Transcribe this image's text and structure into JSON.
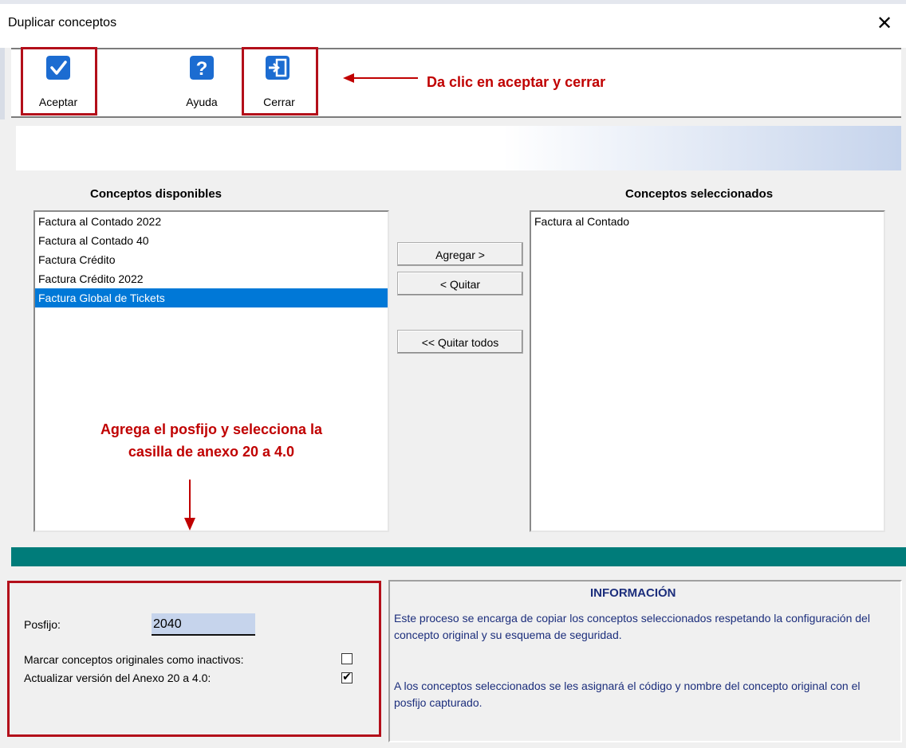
{
  "window": {
    "title": "Duplicar conceptos",
    "close_glyph": "✕"
  },
  "toolbar": {
    "buttons": [
      {
        "label": "Aceptar",
        "icon": "check-icon",
        "color": "#1c6cd1"
      },
      {
        "label": "Ayuda",
        "icon": "help-icon",
        "color": "#1c6cd1"
      },
      {
        "label": "Cerrar",
        "icon": "exit-door-icon",
        "color": "#1c6cd1"
      }
    ]
  },
  "annotations": {
    "toolbar_note": "Da clic en aceptar y cerrar",
    "bottom_note_line1": "Agrega el posfijo y selecciona la",
    "bottom_note_line2": "casilla de anexo 20 a 4.0",
    "color": "#c00000"
  },
  "lists": {
    "available_header": "Conceptos disponibles",
    "selected_header": "Conceptos seleccionados",
    "available_items": [
      "Factura al Contado 2022",
      "Factura al Contado 40",
      "Factura Crédito",
      "Factura Crédito 2022",
      "Factura Global de Tickets"
    ],
    "available_selected_index": 4,
    "selected_items": [
      "Factura al Contado"
    ]
  },
  "buttons": {
    "add": "Agregar >",
    "remove": "< Quitar",
    "remove_all": "<< Quitar todos"
  },
  "options": {
    "posfijo_label": "Posfijo:",
    "posfijo_value": "2040",
    "inactivos_label": "Marcar conceptos originales como inactivos:",
    "inactivos_checked": false,
    "anexo_label": "Actualizar versión del Anexo 20 a 4.0:",
    "anexo_checked": true
  },
  "info": {
    "title": "INFORMACIÓN",
    "paragraph1": "Este proceso se encarga de copiar los conceptos seleccionados respetando la configuración del concepto original y su esquema de seguridad.",
    "paragraph2": "A los conceptos seleccionados se les asignará el código y nombre del concepto original con el posfijo capturado."
  },
  "colors": {
    "teal_bar": "#007c7a",
    "selection": "#0078d7",
    "info_text": "#1c2e7c"
  }
}
